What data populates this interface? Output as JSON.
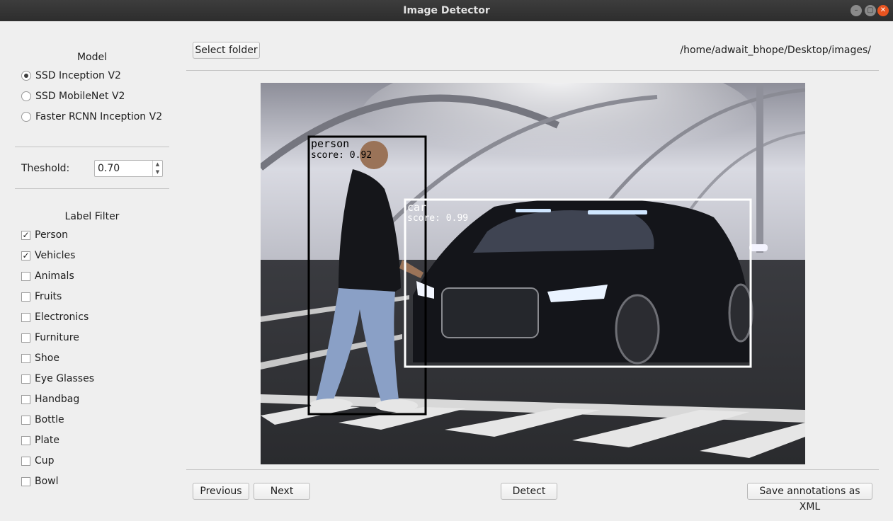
{
  "window": {
    "title": "Image Detector"
  },
  "model": {
    "title": "Model",
    "options": [
      {
        "label": "SSD Inception V2",
        "selected": true
      },
      {
        "label": "SSD MobileNet V2",
        "selected": false
      },
      {
        "label": "Faster RCNN Inception V2",
        "selected": false
      }
    ]
  },
  "threshold": {
    "label": "Theshold:",
    "value": "0.70"
  },
  "label_filter": {
    "title": "Label Filter",
    "items": [
      {
        "label": "Person",
        "checked": true
      },
      {
        "label": "Vehicles",
        "checked": true
      },
      {
        "label": "Animals",
        "checked": false
      },
      {
        "label": "Fruits",
        "checked": false
      },
      {
        "label": "Electronics",
        "checked": false
      },
      {
        "label": "Furniture",
        "checked": false
      },
      {
        "label": "Shoe",
        "checked": false
      },
      {
        "label": "Eye Glasses",
        "checked": false
      },
      {
        "label": "Handbag",
        "checked": false
      },
      {
        "label": "Bottle",
        "checked": false
      },
      {
        "label": "Plate",
        "checked": false
      },
      {
        "label": "Cup",
        "checked": false
      },
      {
        "label": "Bowl",
        "checked": false
      }
    ]
  },
  "toolbar": {
    "select_folder_label": "Select folder",
    "folder_path": "/home/adwait_bhope/Desktop/images/"
  },
  "detections": [
    {
      "label": "person",
      "score_text": "score: 0.92"
    },
    {
      "label": "car",
      "score_text": "score: 0.99"
    }
  ],
  "bottom": {
    "previous_label": "Previous",
    "next_label": "Next",
    "detect_label": "Detect",
    "save_label": "Save annotations as XML"
  },
  "icons": {
    "minimize": "minimize-icon",
    "maximize": "maximize-icon",
    "close": "close-icon",
    "check": "check-icon",
    "spin_up": "spin-up-icon",
    "spin_down": "spin-down-icon"
  },
  "colors": {
    "titlebar": "#2d2d2d",
    "close_button": "#e95420",
    "window_bg": "#efefef"
  }
}
